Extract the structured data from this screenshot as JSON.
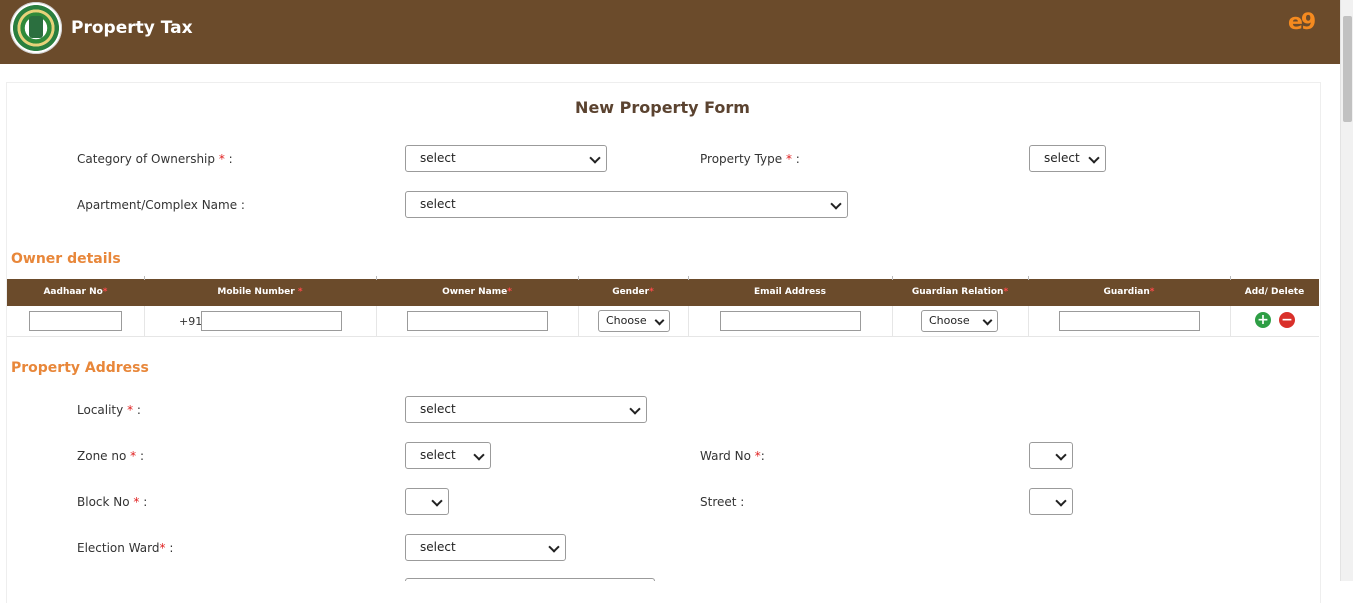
{
  "header": {
    "title": "Property Tax",
    "brand_glyph": "e9"
  },
  "form": {
    "title": "New Property Form",
    "category_label": "Category of Ownership",
    "category_value": "select",
    "property_type_label": "Property Type",
    "property_type_value": "select",
    "apartment_label": "Apartment/Complex Name :",
    "apartment_value": "select",
    "required_mark": "*",
    "colon": " :"
  },
  "owner_details": {
    "title": "Owner details",
    "columns": {
      "aadhaar": "Aadhaar No",
      "mobile": "Mobile Number",
      "owner_name": "Owner Name",
      "gender": "Gender",
      "email": "Email Address",
      "guardian_relation": "Guardian Relation",
      "guardian": "Guardian",
      "add_delete": "Add/ Delete"
    },
    "row": {
      "mobile_prefix": "+91",
      "gender_value": "Choose",
      "guardian_relation_value": "Choose"
    }
  },
  "property_address": {
    "title": "Property Address",
    "locality_label": "Locality",
    "locality_value": "select",
    "zone_label": "Zone no",
    "zone_value": "select",
    "ward_label": "Ward No",
    "ward_colon": ":",
    "ward_value": "",
    "block_label": "Block No",
    "block_value": "",
    "street_label": "Street :",
    "street_value": "",
    "election_label": "Election Ward",
    "election_value": "select"
  },
  "colors": {
    "header_bg": "#6b4b2b",
    "accent": "#e8873a",
    "required": "#e02020"
  }
}
